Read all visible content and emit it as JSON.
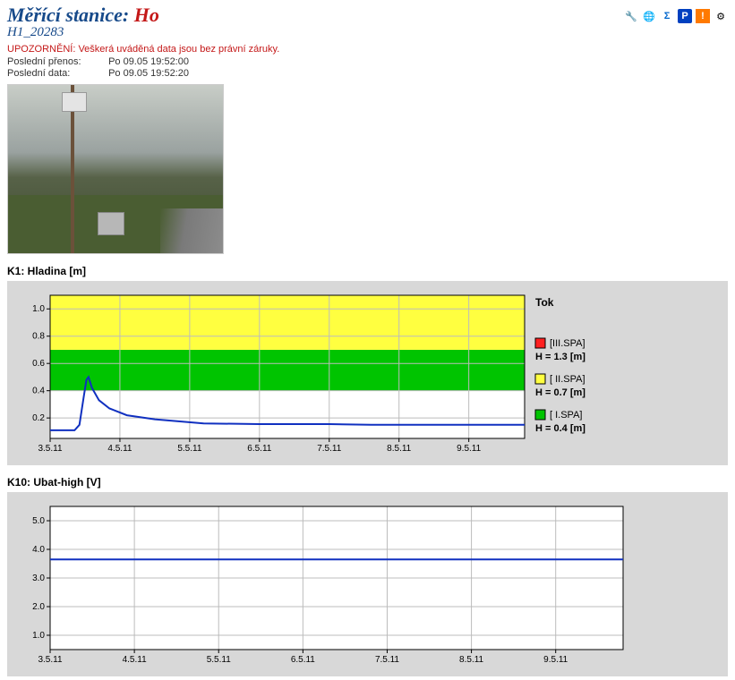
{
  "header": {
    "title_prefix": "Měřící stanice: ",
    "title_name": "Ho",
    "subtitle": "H1_20283"
  },
  "warning": "UPOZORNĚNÍ: Veškerá uváděná data jsou bez právní záruky.",
  "meta": {
    "transfer_label": "Poslední přenos:",
    "transfer_value": "Po 09.05 19:52:00",
    "data_label": "Poslední data:",
    "data_value": "Po 09.05 19:52:20"
  },
  "toolbar_icons": [
    "settings-icon",
    "globe-stats-icon",
    "sigma-icon",
    "parking-icon",
    "alert-icon",
    "gears-icon"
  ],
  "charts": {
    "k1_title": "K1: Hladina [m]",
    "k10_title": "K10: Ubat-high [V]"
  },
  "chart_data": [
    {
      "id": "k1",
      "type": "line",
      "title": "K1: Hladina [m]",
      "xlabel": "",
      "ylabel": "",
      "y_ticks": [
        0.2,
        0.4,
        0.6,
        0.8,
        1.0
      ],
      "ylim": [
        0.05,
        1.1
      ],
      "x_categories": [
        "3.5.11",
        "4.5.11",
        "5.5.11",
        "6.5.11",
        "7.5.11",
        "8.5.11",
        "9.5.11"
      ],
      "bands": [
        {
          "name": "I.SPA",
          "from": 0.4,
          "to": 0.7,
          "color": "#00c400"
        },
        {
          "name": "II.SPA",
          "from": 0.7,
          "to": 1.1,
          "color": "#ffff40"
        },
        {
          "name": "III.SPA",
          "from": 1.3,
          "to": 99,
          "color": "#ff2020"
        }
      ],
      "series": [
        {
          "name": "Hladina",
          "color": "#1030c0",
          "points": [
            [
              0.0,
              0.11
            ],
            [
              0.35,
              0.11
            ],
            [
              0.42,
              0.15
            ],
            [
              0.48,
              0.35
            ],
            [
              0.52,
              0.48
            ],
            [
              0.55,
              0.5
            ],
            [
              0.6,
              0.42
            ],
            [
              0.7,
              0.33
            ],
            [
              0.85,
              0.27
            ],
            [
              1.1,
              0.22
            ],
            [
              1.5,
              0.19
            ],
            [
              2.2,
              0.16
            ],
            [
              3.0,
              0.155
            ],
            [
              3.8,
              0.155
            ],
            [
              4.0,
              0.155
            ],
            [
              4.6,
              0.15
            ],
            [
              5.4,
              0.15
            ],
            [
              6.0,
              0.15
            ],
            [
              6.8,
              0.15
            ]
          ]
        }
      ],
      "legend": {
        "title": "Tok",
        "items": [
          {
            "swatch": "#ff2020",
            "label": "[III.SPA]",
            "value": "H = 1.3 [m]"
          },
          {
            "swatch": "#ffff40",
            "label": "[ II.SPA]",
            "value": "H = 0.7 [m]"
          },
          {
            "swatch": "#00c400",
            "label": "[  I.SPA]",
            "value": "H = 0.4 [m]"
          }
        ]
      }
    },
    {
      "id": "k10",
      "type": "line",
      "title": "K10: Ubat-high [V]",
      "xlabel": "",
      "ylabel": "",
      "y_ticks": [
        1.0,
        2.0,
        3.0,
        4.0,
        5.0
      ],
      "ylim": [
        0.5,
        5.5
      ],
      "x_categories": [
        "3.5.11",
        "4.5.11",
        "5.5.11",
        "6.5.11",
        "7.5.11",
        "8.5.11",
        "9.5.11"
      ],
      "series": [
        {
          "name": "Ubat-high",
          "color": "#1030c0",
          "points": [
            [
              0,
              3.65
            ],
            [
              6.8,
              3.65
            ]
          ]
        }
      ]
    }
  ]
}
